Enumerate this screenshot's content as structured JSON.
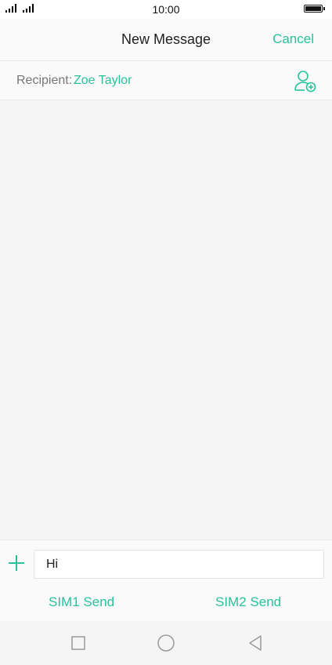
{
  "status_bar": {
    "time": "10:00"
  },
  "header": {
    "title": "New Message",
    "cancel_label": "Cancel"
  },
  "recipient": {
    "label": "Recipient:",
    "name": "Zoe Taylor"
  },
  "compose": {
    "message_value": "Hi",
    "sim1_label": "SIM1 Send",
    "sim2_label": "SIM2 Send"
  },
  "colors": {
    "accent": "#26c39a",
    "background": "#f5f5f5"
  },
  "icons": {
    "add_contact": "add-contact-icon",
    "attach": "plus-icon",
    "recent": "square-icon",
    "home": "circle-icon",
    "back": "triangle-back-icon"
  }
}
